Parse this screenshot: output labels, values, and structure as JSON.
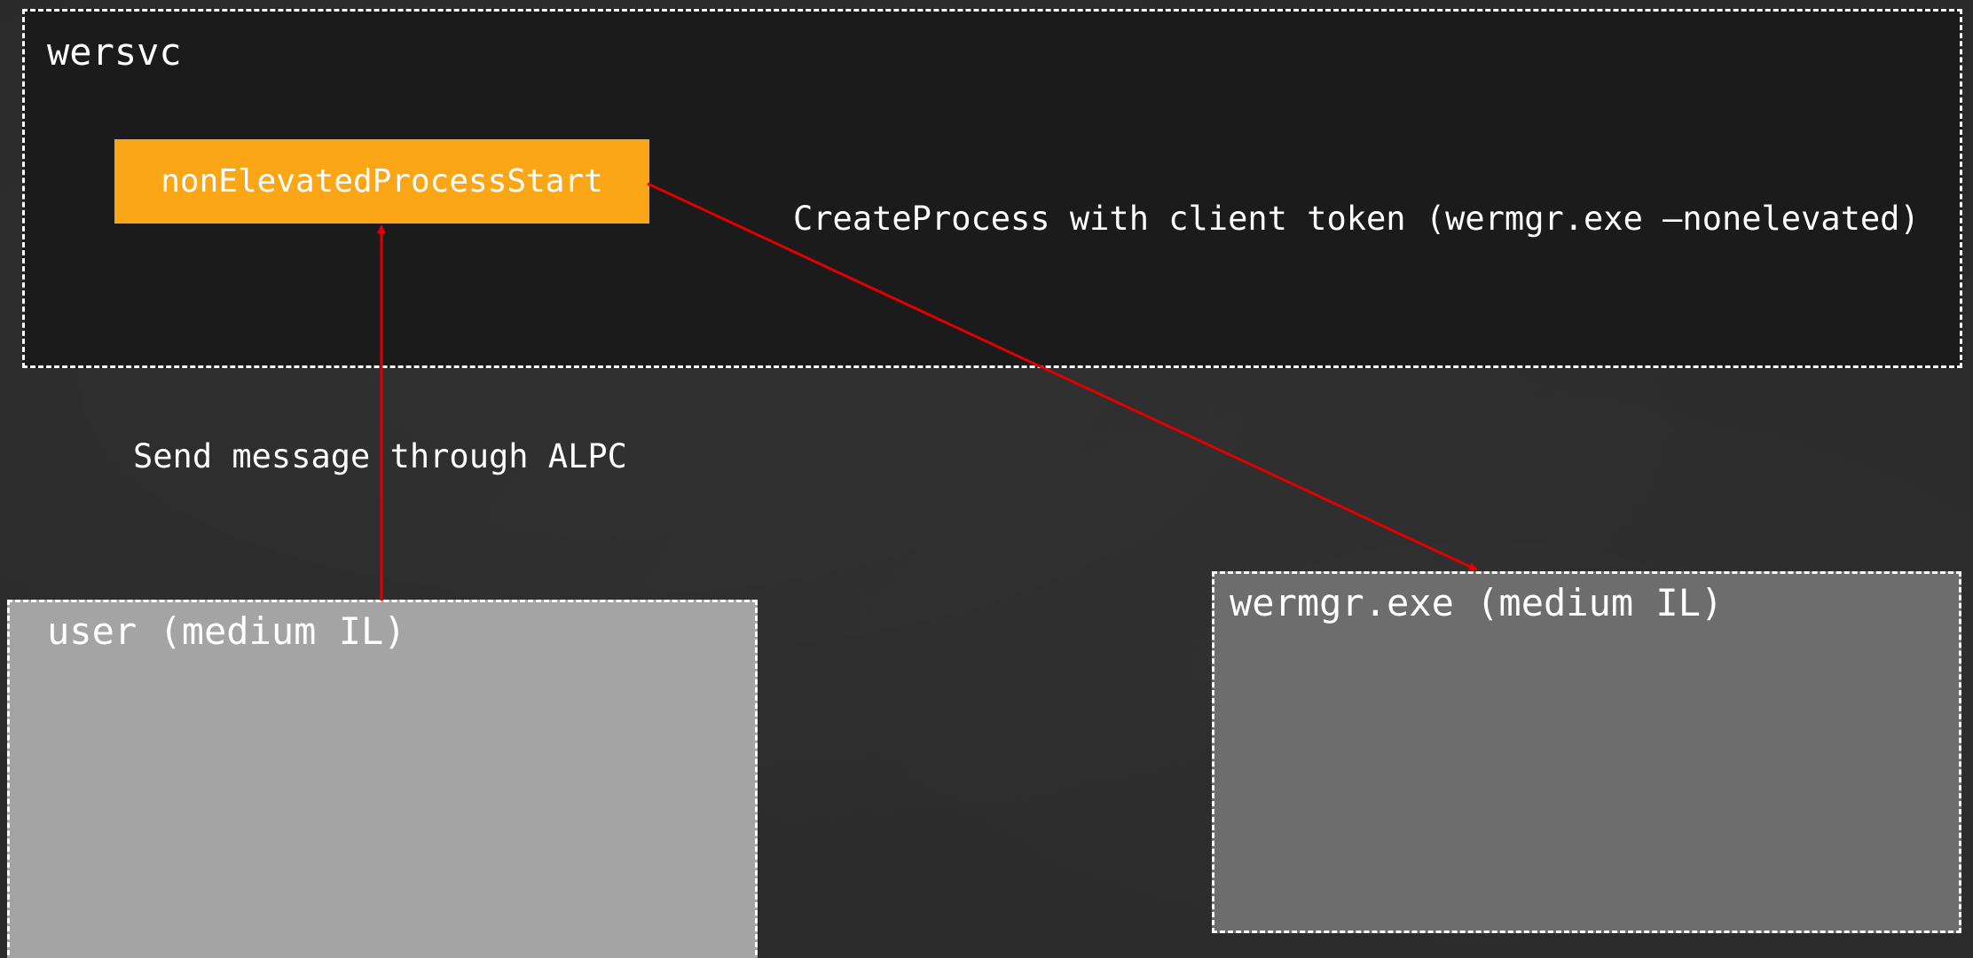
{
  "wersvc": {
    "title": "wersvc"
  },
  "function_box": {
    "label": "nonElevatedProcessStart"
  },
  "user": {
    "title": "user (medium IL)"
  },
  "wermgr": {
    "title": "wermgr.exe (medium IL)"
  },
  "edges": {
    "alpc": {
      "label": "Send message through ALPC",
      "from": "user",
      "to": "nonElevatedProcessStart"
    },
    "create": {
      "label": "CreateProcess with client token (wermgr.exe –nonelevated)",
      "from": "nonElevatedProcessStart",
      "to": "wermgr.exe"
    }
  },
  "colors": {
    "background": "#2a2a2a",
    "wersvc_fill": "#1b1b1b",
    "function_fill": "#fba617",
    "user_fill": "#a4a4a4",
    "wermgr_fill": "#6d6d6d",
    "arrow": "#e00000",
    "text": "#ffffff",
    "border": "#ffffff"
  }
}
